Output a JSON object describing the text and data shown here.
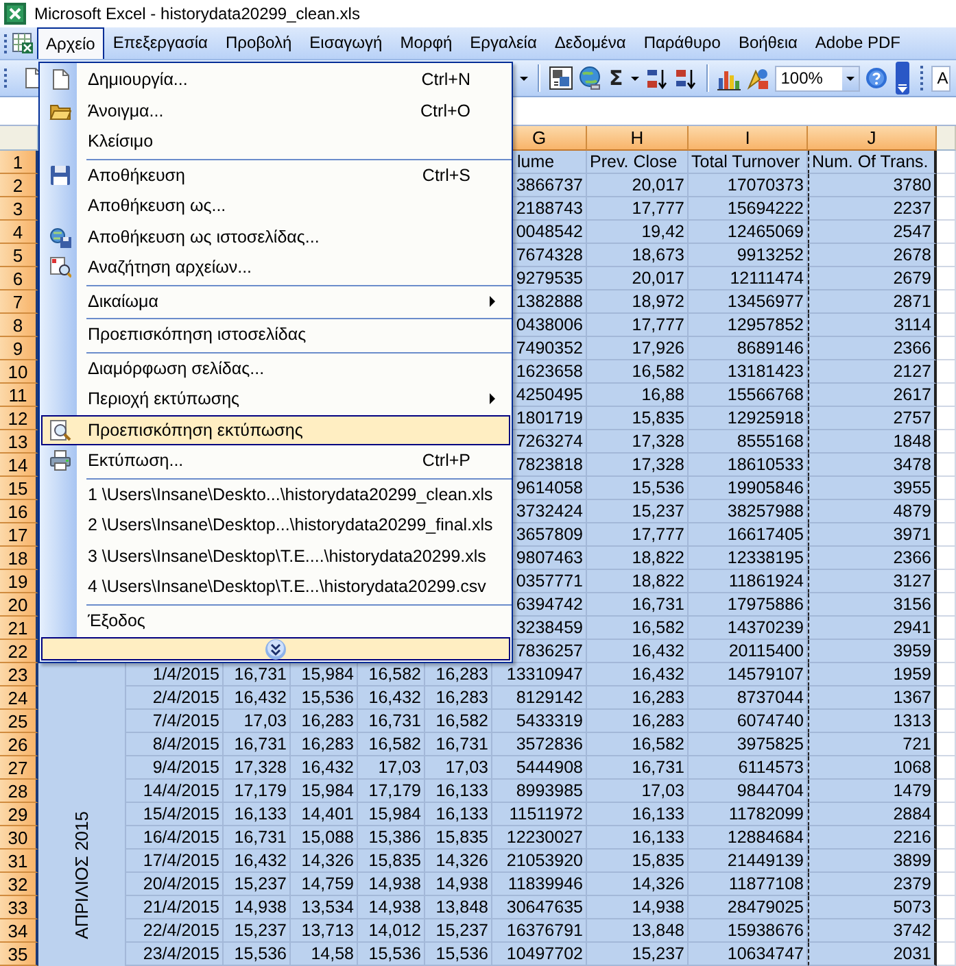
{
  "window": {
    "title": "Microsoft Excel - historydata20299_clean.xls"
  },
  "menu_bar": [
    {
      "label": "Αρχείο",
      "selected": true
    },
    {
      "label": "Επεξεργασία",
      "selected": false
    },
    {
      "label": "Προβολή",
      "selected": false
    },
    {
      "label": "Εισαγωγή",
      "selected": false
    },
    {
      "label": "Μορφή",
      "selected": false
    },
    {
      "label": "Εργαλεία",
      "selected": false
    },
    {
      "label": "Δεδομένα",
      "selected": false
    },
    {
      "label": "Παράθυρο",
      "selected": false
    },
    {
      "label": "Βοήθεια",
      "selected": false
    },
    {
      "label": "Adobe PDF",
      "selected": false
    }
  ],
  "toolbar": {
    "autosum": "Σ",
    "zoom": "100%",
    "font_field": "A"
  },
  "file_menu": {
    "groups": [
      {
        "items": [
          {
            "label": "Δημιουργία...",
            "shortcut": "Ctrl+N",
            "submenu": false,
            "selected": false
          },
          {
            "label": "Άνοιγμα...",
            "shortcut": "Ctrl+O",
            "submenu": false,
            "selected": false
          },
          {
            "label": "Κλείσιμο",
            "submenu": false,
            "selected": false
          }
        ]
      },
      {
        "items": [
          {
            "label": "Αποθήκευση",
            "shortcut": "Ctrl+S",
            "submenu": false,
            "selected": false
          },
          {
            "label": "Αποθήκευση ως...",
            "submenu": false,
            "selected": false
          },
          {
            "label": "Αποθήκευση ως ιστοσελίδας...",
            "submenu": false,
            "selected": false
          },
          {
            "label": "Αναζήτηση αρχείων...",
            "submenu": false,
            "selected": false
          }
        ]
      },
      {
        "items": [
          {
            "label": "Δικαίωμα",
            "submenu": true,
            "selected": false
          }
        ]
      },
      {
        "items": [
          {
            "label": "Προεπισκόπηση ιστοσελίδας",
            "submenu": false,
            "selected": false
          }
        ]
      },
      {
        "items": [
          {
            "label": "Διαμόρφωση σελίδας...",
            "submenu": false,
            "selected": false
          },
          {
            "label": "Περιοχή εκτύπωσης",
            "submenu": true,
            "selected": false
          },
          {
            "label": "Προεπισκόπηση εκτύπωσης",
            "submenu": false,
            "selected": true
          },
          {
            "label": "Εκτύπωση...",
            "shortcut": "Ctrl+P",
            "submenu": false,
            "selected": false
          }
        ]
      },
      {
        "items": [
          {
            "label": "1 \\Users\\Insane\\Deskto...\\historydata20299_clean.xls",
            "submenu": false,
            "selected": false
          },
          {
            "label": "2 \\Users\\Insane\\Desktop...\\historydata20299_final.xls",
            "submenu": false,
            "selected": false
          },
          {
            "label": "3 \\Users\\Insane\\Desktop\\T.E....\\historydata20299.xls",
            "submenu": false,
            "selected": false
          },
          {
            "label": "4 \\Users\\Insane\\Desktop\\T.E...\\historydata20299.csv",
            "submenu": false,
            "selected": false
          }
        ]
      },
      {
        "items": [
          {
            "label": "Έξοδος",
            "submenu": false,
            "selected": false
          }
        ]
      }
    ]
  },
  "sheet": {
    "column_headers": [
      {
        "label": "G",
        "selected": true,
        "marquee": false
      },
      {
        "label": "H",
        "selected": true,
        "marquee": false
      },
      {
        "label": "I",
        "selected": true,
        "marquee": false
      },
      {
        "label": "J",
        "selected": true,
        "marquee": true
      }
    ],
    "month_label": "ΑΠΡΙΛΙΟΣ 2015",
    "rows_beside_menu": [
      {
        "number": "1",
        "selected": true,
        "kind": "titles",
        "cells": [
          "lume",
          "Prev. Close",
          "Total Turnover",
          "Num. Of Trans."
        ]
      },
      {
        "number": "2",
        "selected": true,
        "kind": "data",
        "cells": [
          "3866737",
          "20,017",
          "17070373",
          "3780"
        ]
      },
      {
        "number": "3",
        "selected": true,
        "kind": "data",
        "cells": [
          "2188743",
          "17,777",
          "15694222",
          "2237"
        ]
      },
      {
        "number": "4",
        "selected": true,
        "kind": "data",
        "cells": [
          "0048542",
          "19,42",
          "12465069",
          "2547"
        ]
      },
      {
        "number": "5",
        "selected": true,
        "kind": "data",
        "cells": [
          "7674328",
          "18,673",
          "9913252",
          "2678"
        ]
      },
      {
        "number": "6",
        "selected": true,
        "kind": "data",
        "cells": [
          "9279535",
          "20,017",
          "12111474",
          "2679"
        ]
      },
      {
        "number": "7",
        "selected": true,
        "kind": "data",
        "cells": [
          "1382888",
          "18,972",
          "13456977",
          "2871"
        ]
      },
      {
        "number": "8",
        "selected": true,
        "kind": "data",
        "cells": [
          "0438006",
          "17,777",
          "12957852",
          "3114"
        ]
      },
      {
        "number": "9",
        "selected": true,
        "kind": "data",
        "cells": [
          "7490352",
          "17,926",
          "8689146",
          "2366"
        ]
      },
      {
        "number": "10",
        "selected": true,
        "kind": "data",
        "cells": [
          "1623658",
          "16,582",
          "13181423",
          "2127"
        ]
      },
      {
        "number": "11",
        "selected": true,
        "kind": "data",
        "cells": [
          "4250495",
          "16,88",
          "15566768",
          "2617"
        ]
      },
      {
        "number": "12",
        "selected": true,
        "kind": "data",
        "cells": [
          "1801719",
          "15,835",
          "12925918",
          "2757"
        ]
      },
      {
        "number": "13",
        "selected": true,
        "kind": "data",
        "cells": [
          "7263274",
          "17,328",
          "8555168",
          "1848"
        ]
      },
      {
        "number": "14",
        "selected": true,
        "kind": "data",
        "cells": [
          "7823818",
          "17,328",
          "18610533",
          "3478"
        ]
      },
      {
        "number": "15",
        "selected": true,
        "kind": "data",
        "cells": [
          "9614058",
          "15,536",
          "19905846",
          "3955"
        ]
      },
      {
        "number": "16",
        "selected": true,
        "kind": "data",
        "cells": [
          "3732424",
          "15,237",
          "38257988",
          "4879"
        ]
      },
      {
        "number": "17",
        "selected": true,
        "kind": "data",
        "cells": [
          "3657809",
          "17,777",
          "16617405",
          "3971"
        ]
      },
      {
        "number": "18",
        "selected": true,
        "kind": "data",
        "cells": [
          "9807463",
          "18,822",
          "12338195",
          "2366"
        ]
      },
      {
        "number": "19",
        "selected": true,
        "kind": "data",
        "cells": [
          "0357771",
          "18,822",
          "11861924",
          "3127"
        ]
      },
      {
        "number": "20",
        "selected": true,
        "kind": "data",
        "cells": [
          "6394742",
          "16,731",
          "17975886",
          "3156"
        ]
      },
      {
        "number": "21",
        "selected": true,
        "kind": "data",
        "cells": [
          "3238459",
          "16,582",
          "14370239",
          "2941"
        ]
      },
      {
        "number": "22",
        "selected": true,
        "kind": "data",
        "cells": [
          "7836257",
          "16,432",
          "20115400",
          "3959"
        ]
      }
    ],
    "rows_below_menu": [
      {
        "number": "23",
        "selected": true,
        "cells": [
          "1/4/2015",
          "16,731",
          "15,984",
          "16,582",
          "16,283",
          "13310947",
          "16,432",
          "14579107",
          "1959"
        ]
      },
      {
        "number": "24",
        "selected": true,
        "cells": [
          "2/4/2015",
          "16,432",
          "15,536",
          "16,432",
          "16,283",
          "8129142",
          "16,283",
          "8737044",
          "1367"
        ]
      },
      {
        "number": "25",
        "selected": true,
        "cells": [
          "7/4/2015",
          "17,03",
          "16,283",
          "16,731",
          "16,582",
          "5433319",
          "16,283",
          "6074740",
          "1313"
        ]
      },
      {
        "number": "26",
        "selected": true,
        "cells": [
          "8/4/2015",
          "16,731",
          "16,283",
          "16,582",
          "16,731",
          "3572836",
          "16,582",
          "3975825",
          "721"
        ]
      },
      {
        "number": "27",
        "selected": true,
        "cells": [
          "9/4/2015",
          "17,328",
          "16,432",
          "17,03",
          "17,03",
          "5444908",
          "16,731",
          "6114573",
          "1068"
        ]
      },
      {
        "number": "28",
        "selected": true,
        "cells": [
          "14/4/2015",
          "17,179",
          "15,984",
          "17,179",
          "16,133",
          "8993985",
          "17,03",
          "9844704",
          "1479"
        ]
      },
      {
        "number": "29",
        "selected": true,
        "cells": [
          "15/4/2015",
          "16,133",
          "14,401",
          "15,984",
          "16,133",
          "11511972",
          "16,133",
          "11782099",
          "2884"
        ]
      },
      {
        "number": "30",
        "selected": true,
        "cells": [
          "16/4/2015",
          "16,731",
          "15,088",
          "15,386",
          "15,835",
          "12230027",
          "16,133",
          "12884684",
          "2216"
        ]
      },
      {
        "number": "31",
        "selected": true,
        "cells": [
          "17/4/2015",
          "16,432",
          "14,326",
          "15,835",
          "14,326",
          "21053920",
          "15,835",
          "21449139",
          "3899"
        ]
      },
      {
        "number": "32",
        "selected": true,
        "cells": [
          "20/4/2015",
          "15,237",
          "14,759",
          "14,938",
          "14,938",
          "11839946",
          "14,326",
          "11877108",
          "2379"
        ]
      },
      {
        "number": "33",
        "selected": true,
        "cells": [
          "21/4/2015",
          "14,938",
          "13,534",
          "14,938",
          "13,848",
          "30647635",
          "14,938",
          "28479025",
          "5073"
        ]
      },
      {
        "number": "34",
        "selected": true,
        "cells": [
          "22/4/2015",
          "15,237",
          "13,713",
          "14,012",
          "15,237",
          "16376791",
          "13,848",
          "15938676",
          "3742"
        ]
      },
      {
        "number": "35",
        "selected": true,
        "cells": [
          "23/4/2015",
          "15,536",
          "14,58",
          "15,536",
          "15,536",
          "10497702",
          "15,237",
          "10634747",
          "2031"
        ]
      }
    ]
  }
}
